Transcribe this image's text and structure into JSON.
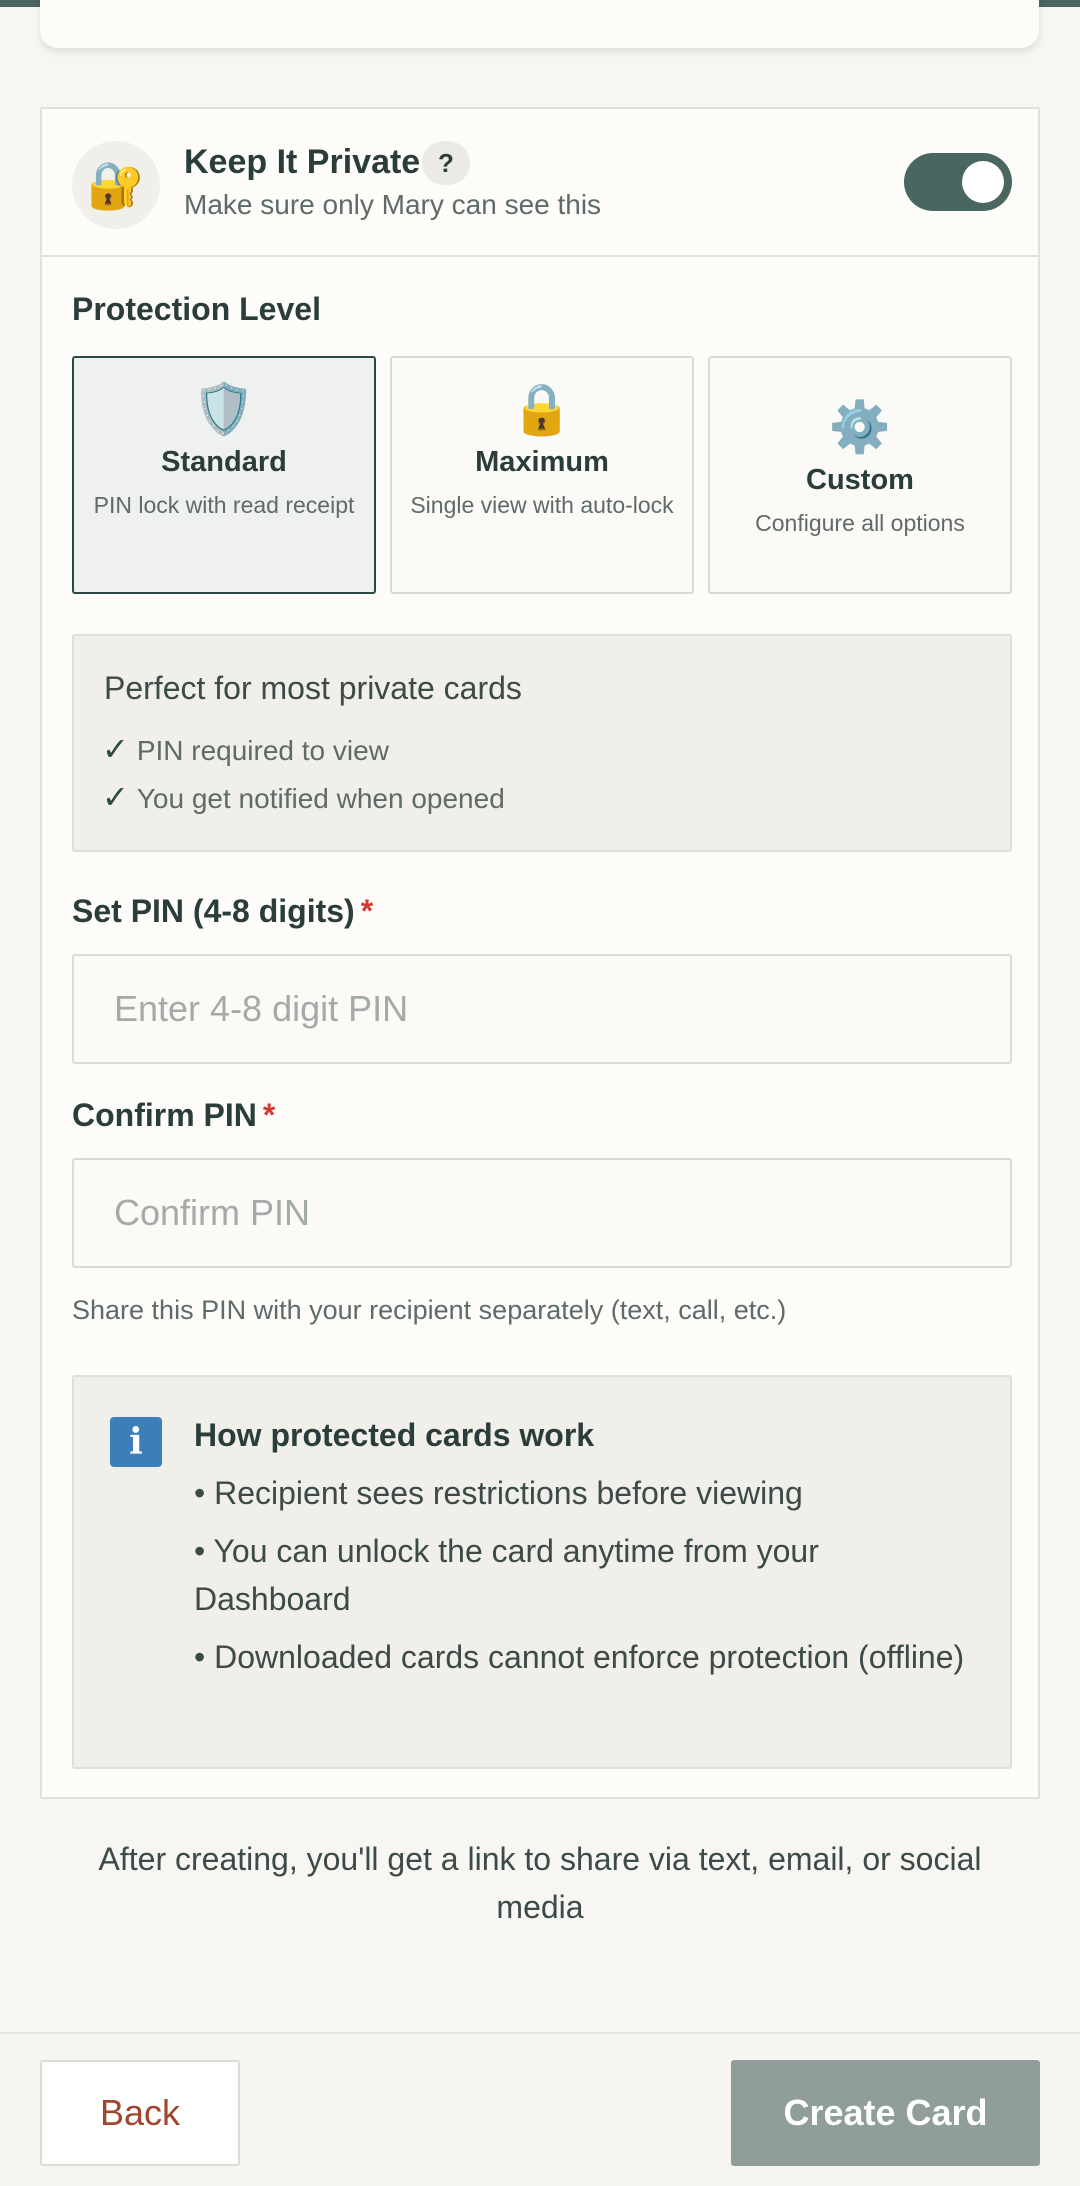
{
  "privacy": {
    "title": "Keep It Private",
    "help_label": "?",
    "subtitle": "Make sure only Mary can see this",
    "lock_icon": "🔐",
    "toggle_on": true
  },
  "protection": {
    "label": "Protection Level",
    "options": [
      {
        "icon": "🛡️",
        "icon_name": "shield-icon",
        "title": "Standard",
        "desc": "PIN lock with read receipt",
        "selected": true
      },
      {
        "icon": "🔒",
        "icon_name": "lock-icon",
        "title": "Maximum",
        "desc": "Single view with auto-lock",
        "selected": false
      },
      {
        "icon": "⚙️",
        "icon_name": "gear-icon",
        "title": "Custom",
        "desc": "Configure all options",
        "selected": false
      }
    ]
  },
  "standard_info": {
    "title": "Perfect for most private cards",
    "items": [
      "PIN required to view",
      "You get notified when opened"
    ]
  },
  "pin": {
    "label": "Set PIN (4-8 digits)",
    "placeholder": "Enter 4-8 digit PIN",
    "value": "",
    "confirm_label": "Confirm PIN",
    "confirm_placeholder": "Confirm PIN",
    "confirm_value": "",
    "required_mark": "*",
    "hint": "Share this PIN with your recipient separately (text, call, etc.)"
  },
  "how_it_works": {
    "icon": "i",
    "title": "How protected cards work",
    "items": [
      "• Recipient sees restrictions before viewing",
      "• You can unlock the card anytime from your Dashboard",
      "• Downloaded cards cannot enforce protection (offline)"
    ]
  },
  "after_text": "After creating, you'll get a link to share via text, email, or social media",
  "footer": {
    "back_label": "Back",
    "create_label": "Create Card"
  },
  "colors": {
    "accent": "#4a6661",
    "selected_border": "#2c4a45",
    "required": "#d23a36",
    "back_text": "#a0452e",
    "create_disabled": "#8f9e9b",
    "info_icon": "#3d7db8"
  }
}
